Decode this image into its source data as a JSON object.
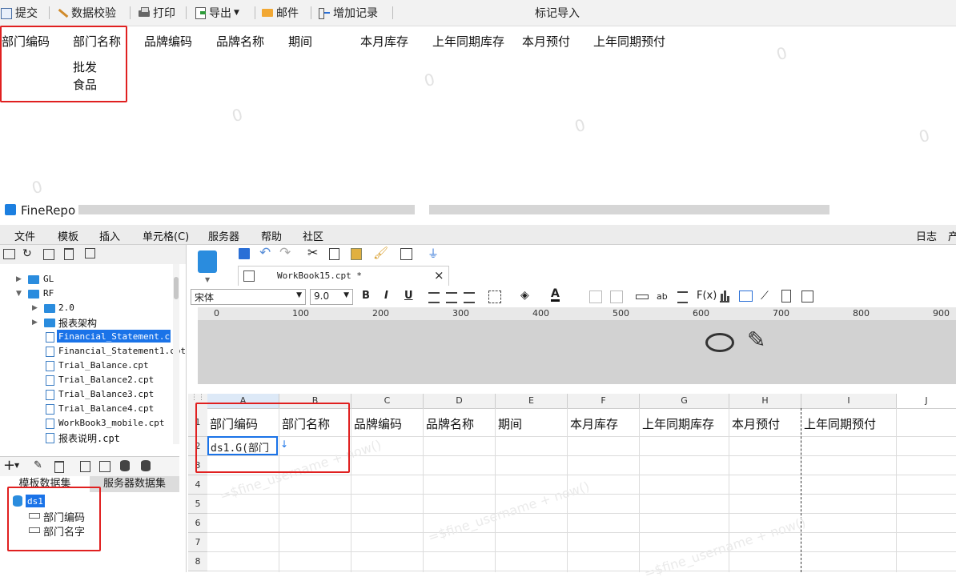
{
  "preview": {
    "toolbar": {
      "submit": "提交",
      "verify": "数据校验",
      "print": "打印",
      "export": "导出",
      "mail": "邮件",
      "add_record": "增加记录",
      "mark_import": "标记导入"
    },
    "headers": [
      "部门编码",
      "部门名称",
      "品牌编码",
      "品牌名称",
      "期间",
      "本月库存",
      "上年同期库存",
      "本月预付",
      "上年同期预付"
    ],
    "dept_name_values": [
      "批发",
      "食品"
    ],
    "watermark": "0"
  },
  "designer": {
    "app_title": "FineRepo",
    "menu": [
      "文件",
      "模板",
      "插入",
      "单元格(C)",
      "服务器",
      "帮助",
      "社区"
    ],
    "menu_right": [
      "日志",
      "产"
    ],
    "file_tab": "WorkBook15.cpt *",
    "font_name": "宋体",
    "font_size": "9.0",
    "format_buttons": [
      "B",
      "I",
      "U"
    ],
    "tree": {
      "top_items": [
        {
          "label": "GL"
        },
        {
          "label": "RF"
        }
      ],
      "rf_children_folders": [
        "2.0",
        "报表架构"
      ],
      "files": [
        "Financial_Statement.cpt",
        "Financial_Statement1.cpt",
        "Trial_Balance.cpt",
        "Trial_Balance2.cpt",
        "Trial_Balance3.cpt",
        "Trial_Balance4.cpt",
        "WorkBook3_mobile.cpt",
        "报表说明.cpt"
      ],
      "selected_file": "Financial_Statement.cpt"
    },
    "dataset_tabs": [
      "模板数据集",
      "服务器数据集"
    ],
    "dataset": {
      "name": "ds1",
      "fields": [
        "部门编码",
        "部门名字"
      ]
    },
    "ruler_labels": [
      "0",
      "100",
      "200",
      "300",
      "400",
      "500",
      "600",
      "700",
      "800",
      "900"
    ],
    "columns": [
      "A",
      "B",
      "C",
      "D",
      "E",
      "F",
      "G",
      "H",
      "I",
      "J"
    ],
    "rows": [
      "1",
      "2",
      "3",
      "4",
      "5",
      "6",
      "7",
      "8"
    ],
    "grid_headers": [
      "部门编码",
      "部门名称",
      "品牌编码",
      "品牌名称",
      "期间",
      "本月库存",
      "上年同期库存",
      "本月预付",
      "上年同期预付"
    ],
    "cell_a2": "ds1.G(部门",
    "grid_watermark": "=$fine_username + now()"
  },
  "colors": {
    "highlight_red": "#e02020",
    "selection_blue": "#1a73e8",
    "folder_blue": "#2a8cde"
  }
}
